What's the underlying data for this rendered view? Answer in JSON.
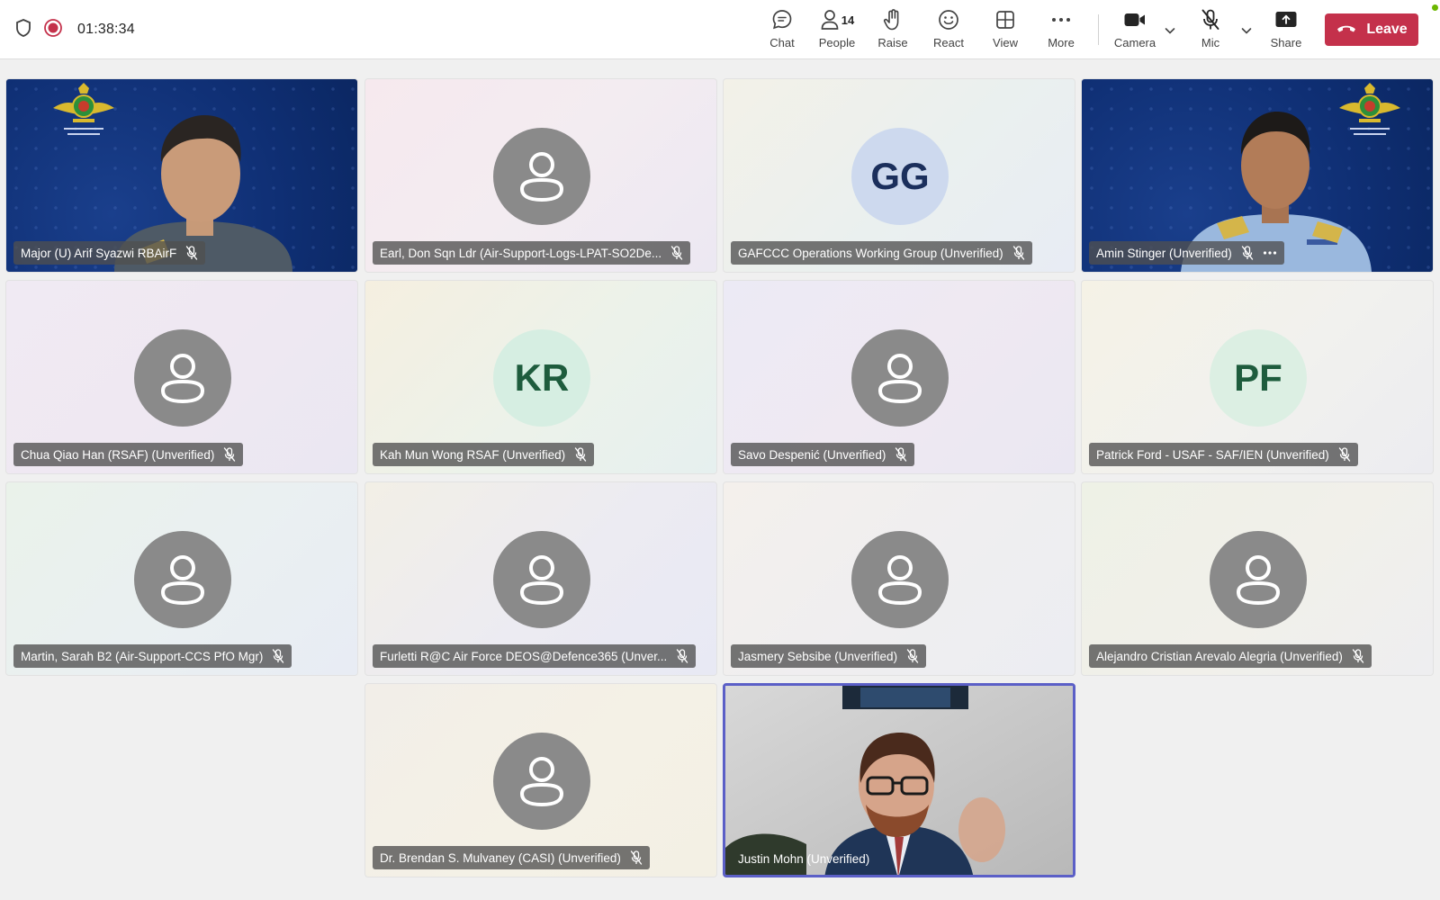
{
  "topbar": {
    "timer": "01:38:34",
    "chat": "Chat",
    "people": "People",
    "people_count": "14",
    "raise": "Raise",
    "react": "React",
    "view": "View",
    "more": "More",
    "camera": "Camera",
    "mic": "Mic",
    "share": "Share",
    "leave": "Leave"
  },
  "participants": [
    {
      "name": "Major (U) Arif Syazwi RBAirF",
      "avatar": "video",
      "muted": true
    },
    {
      "name": "Earl, Don Sqn Ldr (Air-Support-Logs-LPAT-SO2De...",
      "avatar": "generic",
      "muted": true
    },
    {
      "name": "GAFCCC Operations Working Group (Unverified)",
      "avatar": "initials",
      "initials": "GG",
      "muted": true
    },
    {
      "name": "Amin Stinger (Unverified)",
      "avatar": "video",
      "muted": true
    },
    {
      "name": "Chua Qiao Han (RSAF) (Unverified)",
      "avatar": "generic",
      "muted": true
    },
    {
      "name": "Kah Mun Wong RSAF (Unverified)",
      "avatar": "initials",
      "initials": "KR",
      "muted": true
    },
    {
      "name": "Savo Despenić (Unverified)",
      "avatar": "generic",
      "muted": true
    },
    {
      "name": "Patrick Ford - USAF - SAF/IEN (Unverified)",
      "avatar": "initials",
      "initials": "PF",
      "muted": true
    },
    {
      "name": "Martin, Sarah B2 (Air-Support-CCS PfO Mgr)",
      "avatar": "generic",
      "muted": true
    },
    {
      "name": "Furletti R@C Air Force DEOS@Defence365 (Unver...",
      "avatar": "generic",
      "muted": true
    },
    {
      "name": "Jasmery Sebsibe (Unverified)",
      "avatar": "generic",
      "muted": true
    },
    {
      "name": "Alejandro Cristian Arevalo Alegria (Unverified)",
      "avatar": "generic",
      "muted": true
    },
    {
      "name": "Dr. Brendan S. Mulvaney (CASI) (Unverified)",
      "avatar": "generic",
      "muted": true
    },
    {
      "name": "Justin Mohn (Unverified)",
      "avatar": "video",
      "muted": false,
      "active_speaker": true
    }
  ],
  "colors": {
    "leave": "#c4314b",
    "active_speaker_border": "#5b5fc7",
    "generic_avatar": "#8a8a8a",
    "gg_bg": "#cdd9ee",
    "gg_fg": "#1b2f5c",
    "kr_bg": "#d6eee2",
    "kr_fg": "#1e5c3d",
    "pf_bg": "#dcefe3",
    "pf_fg": "#1e5c3d"
  }
}
